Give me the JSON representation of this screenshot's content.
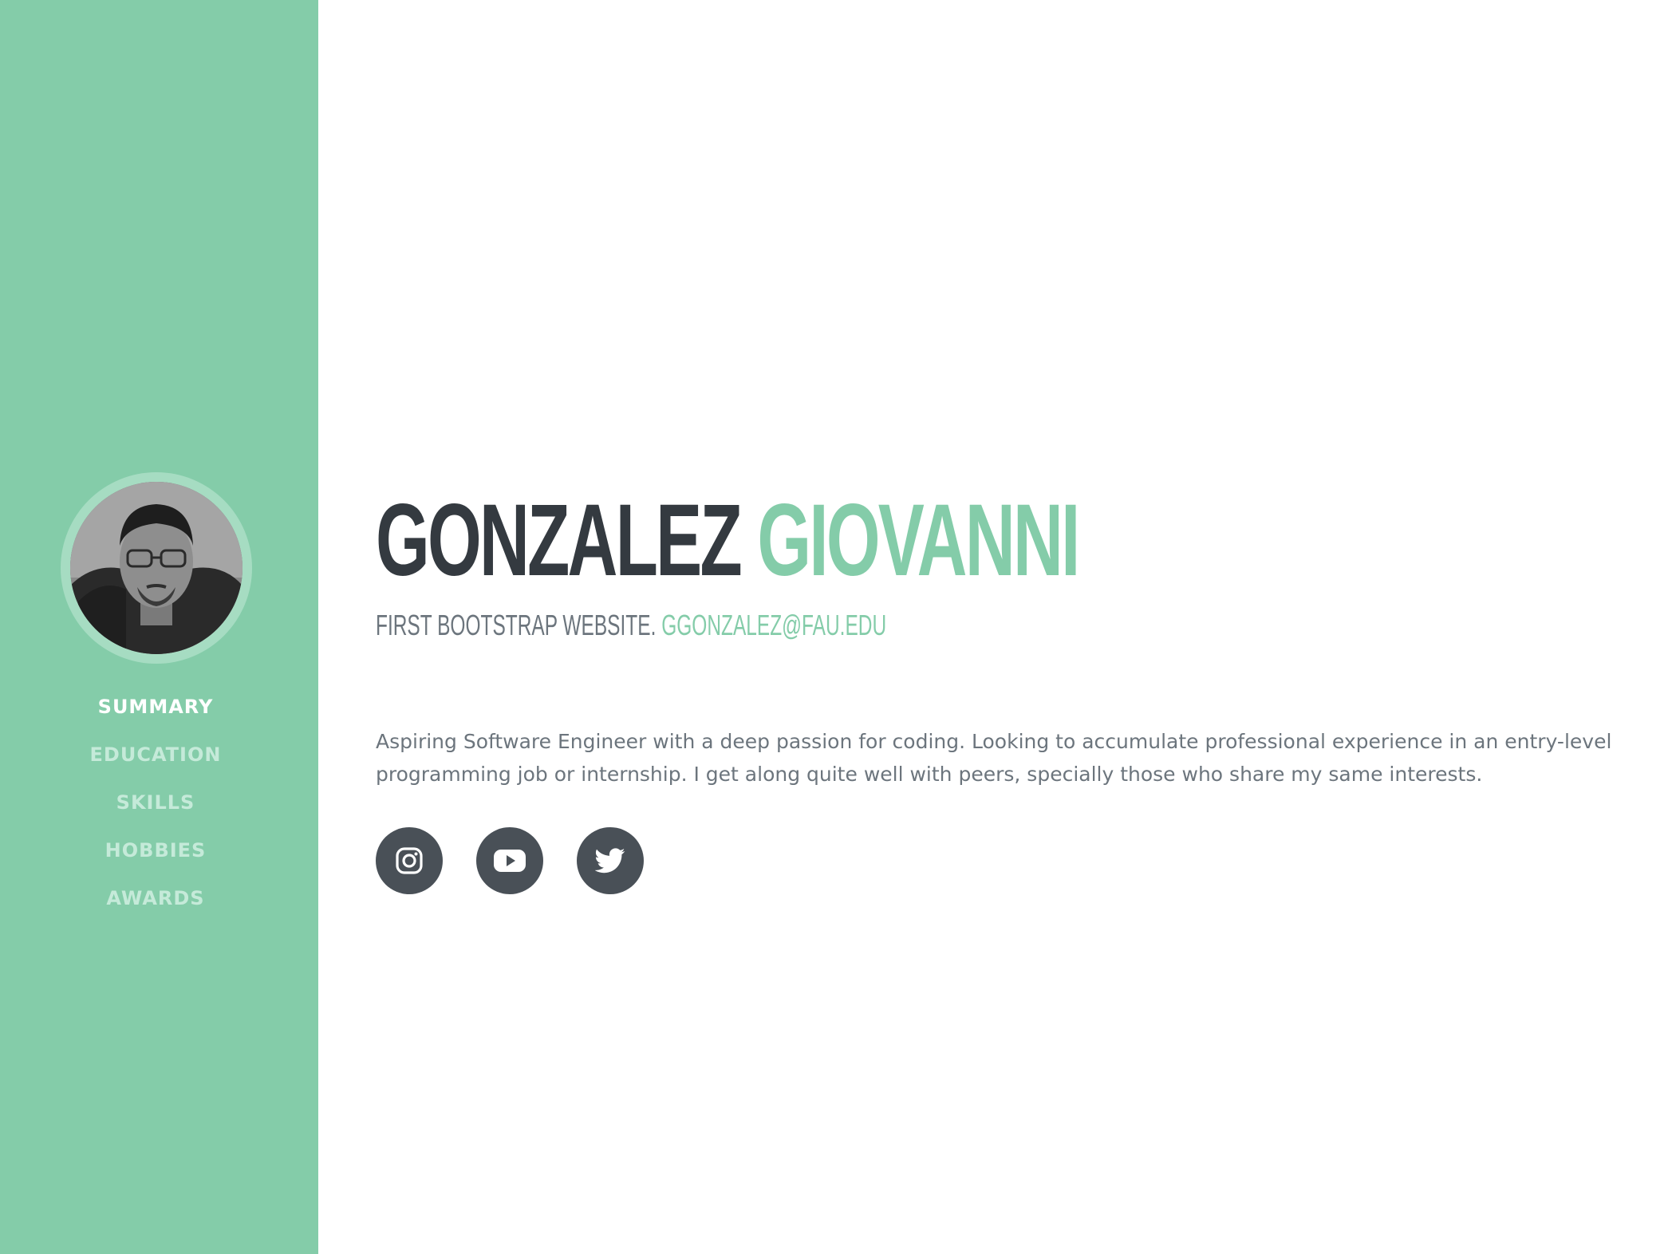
{
  "sidebar": {
    "avatar_alt": "Profile photo",
    "nav": [
      {
        "label": "SUMMARY",
        "active": true
      },
      {
        "label": "EDUCATION",
        "active": false
      },
      {
        "label": "SKILLS",
        "active": false
      },
      {
        "label": "HOBBIES",
        "active": false
      },
      {
        "label": "AWARDS",
        "active": false
      }
    ]
  },
  "header": {
    "last_name": "GONZALEZ",
    "first_name": "GIOVANNI",
    "subheading": "FIRST BOOTSTRAP WEBSITE.",
    "email": "GGONZALEZ@FAU.EDU"
  },
  "summary": {
    "text": "Aspiring Software Engineer with a deep passion for coding. Looking to accumulate professional experience in an entry-level programming job or internship. I get along quite well with peers, specially those who share my same interests."
  },
  "social": {
    "links": [
      {
        "icon": "instagram-icon"
      },
      {
        "icon": "youtube-icon"
      },
      {
        "icon": "twitter-icon"
      }
    ]
  },
  "colors": {
    "sidebar": "#84cca9",
    "accent": "#84cca9",
    "dark_text": "#343a40",
    "muted_text": "#6c757d",
    "social_bg": "#495057",
    "nav_inactive": "#c5ead9",
    "nav_active": "#ffffff"
  }
}
